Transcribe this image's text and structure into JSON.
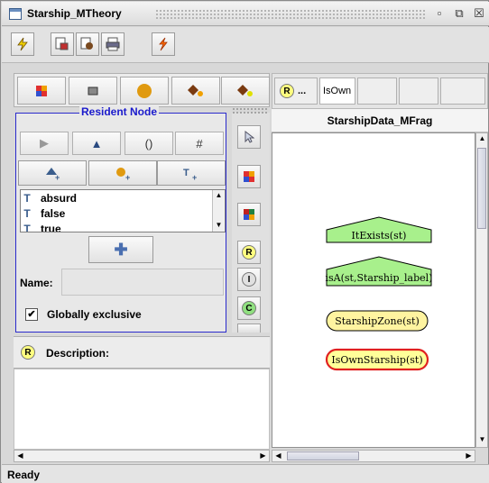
{
  "window": {
    "title": "Starship_MTheory",
    "controls": [
      "minimize-icon",
      "maximize-icon",
      "close-icon"
    ]
  },
  "toolbar": {
    "buttons": [
      "lightning-save-icon",
      "mtheory-icon",
      "mfrag-icon",
      "print-icon",
      "compile-icon"
    ]
  },
  "shape_toolbar": {
    "buttons": [
      "resident-node-icon",
      "rectangle-icon",
      "circle-node-icon",
      "input-node-icon",
      "context-node-icon"
    ]
  },
  "resident_node": {
    "section_title": "Resident Node",
    "nav_buttons": [
      "▶",
      "▲",
      "()",
      "#"
    ],
    "states": [
      {
        "icon": "T",
        "label": "absurd"
      },
      {
        "icon": "T",
        "label": "false"
      },
      {
        "icon": "T",
        "label": "true"
      }
    ],
    "add_label": "✚",
    "name_label": "Name:",
    "name_value": "",
    "globally_exclusive_label": "Globally exclusive",
    "globally_exclusive_checked": "✔"
  },
  "side_tools": [
    "pointer-icon",
    "edit-icon",
    "edit2-icon",
    "R",
    "I",
    "C"
  ],
  "description": {
    "badge": "R",
    "label": "Description:",
    "value": ""
  },
  "right_panel": {
    "tab_badge": "R",
    "tab_ellipsis": "...",
    "tab_label": "IsOwn",
    "frag_title": "StarshipData_MFrag",
    "nodes": [
      {
        "label": "ItExists(st)",
        "kind": "context"
      },
      {
        "label": "isA(st,Starship_label)",
        "kind": "context"
      },
      {
        "label": "StarshipZone(st)",
        "kind": "input"
      },
      {
        "label": "IsOwnStarship(st)",
        "kind": "resident"
      }
    ],
    "colors": {
      "context": "#a8f08c",
      "input": "#fff4a0",
      "resident": "#ffff99",
      "resident_border": "#e02020"
    }
  },
  "status": "Ready"
}
